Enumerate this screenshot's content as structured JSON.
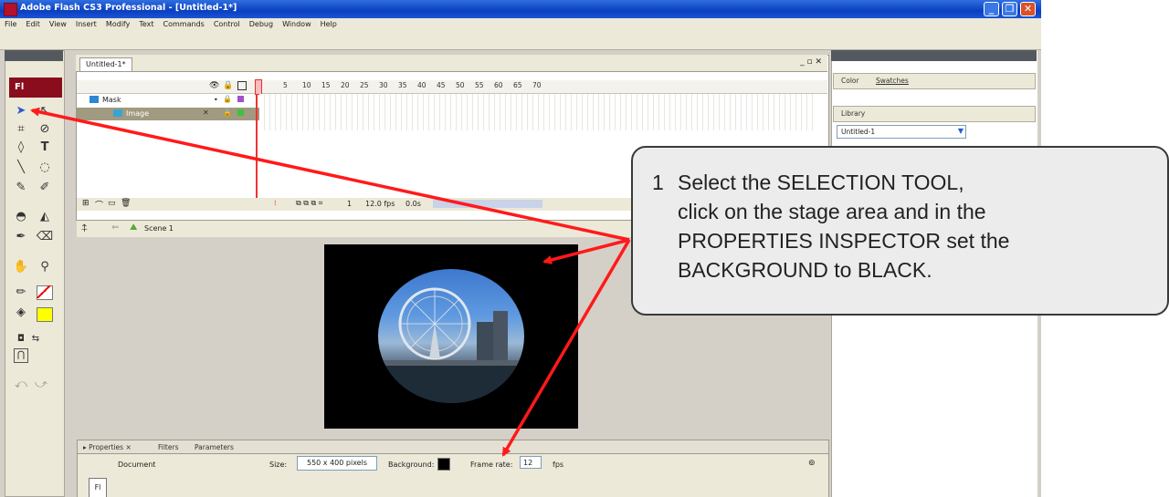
{
  "window": {
    "title": "Adobe Flash CS3 Professional - [Untitled-1*]"
  },
  "menu": [
    "File",
    "Edit",
    "View",
    "Insert",
    "Modify",
    "Text",
    "Commands",
    "Control",
    "Debug",
    "Window",
    "Help"
  ],
  "toolbox": {
    "badge": "Fl"
  },
  "timeline": {
    "doc_tab": "Untitled-1*",
    "frame_numbers": [
      "5",
      "10",
      "15",
      "20",
      "25",
      "30",
      "35",
      "40",
      "45",
      "50",
      "55",
      "60",
      "65",
      "70"
    ],
    "layers": [
      "Mask",
      "Image"
    ],
    "footer_frame": "1",
    "footer_fps": "12.0 fps",
    "footer_time": "0.0s",
    "scene": "Scene 1"
  },
  "properties": {
    "tabs": [
      "Properties",
      "Filters",
      "Parameters"
    ],
    "doc_label": "Document",
    "size_label": "Size:",
    "size_value": "550 x 400 pixels",
    "background_label": "Background:",
    "background_color": "#000000",
    "frame_rate_label": "Frame rate:",
    "frame_rate_value": "12",
    "fps_label": "fps"
  },
  "right_panels": {
    "color_tab": "Color",
    "swatches_tab": "Swatches",
    "library_tab": "Library",
    "library_doc": "Untitled-1"
  },
  "callout": {
    "number": "1",
    "text": "Select the SELECTION TOOL,\nclick on the stage area and in the\nPROPERTIES INSPECTOR set the\nBACKGROUND to BLACK."
  },
  "colors": {
    "arrow": "#ff1a1a",
    "title_bar": "#0a3fbf",
    "flash_red": "#8a0d1d"
  }
}
